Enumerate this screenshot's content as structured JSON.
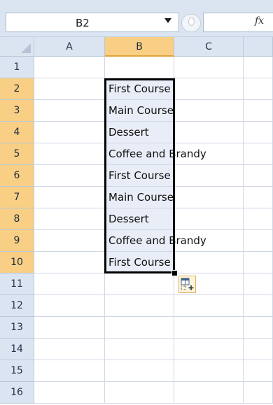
{
  "formula_bar": {
    "name_box": "B2",
    "function_label": "fx"
  },
  "columns": [
    {
      "label": "A",
      "selected": false
    },
    {
      "label": "B",
      "selected": true
    },
    {
      "label": "C",
      "selected": false
    }
  ],
  "rows": [
    {
      "label": "1",
      "selected": false,
      "b": ""
    },
    {
      "label": "2",
      "selected": true,
      "b": "First Course"
    },
    {
      "label": "3",
      "selected": true,
      "b": "Main Course"
    },
    {
      "label": "4",
      "selected": true,
      "b": "Dessert"
    },
    {
      "label": "5",
      "selected": true,
      "b": "Coffee and Brandy"
    },
    {
      "label": "6",
      "selected": true,
      "b": "First Course"
    },
    {
      "label": "7",
      "selected": true,
      "b": "Main Course"
    },
    {
      "label": "8",
      "selected": true,
      "b": "Dessert"
    },
    {
      "label": "9",
      "selected": true,
      "b": "Coffee and Brandy"
    },
    {
      "label": "10",
      "selected": true,
      "b": "First Course"
    },
    {
      "label": "11",
      "selected": false,
      "b": ""
    },
    {
      "label": "12",
      "selected": false,
      "b": ""
    },
    {
      "label": "13",
      "selected": false,
      "b": ""
    },
    {
      "label": "14",
      "selected": false,
      "b": ""
    },
    {
      "label": "15",
      "selected": false,
      "b": ""
    },
    {
      "label": "16",
      "selected": false,
      "b": ""
    }
  ],
  "selection": {
    "start": "B2",
    "end": "B10"
  },
  "colors": {
    "header_bg": "#dbe5f1",
    "header_selected_bg": "#f8cf84",
    "selection_bg": "#e9edf7",
    "gridline": "#d0d7e5",
    "selection_border": "#000000"
  },
  "icons": {
    "name_box_dropdown": "chevron-down-icon",
    "formula_bar_expander": "oval-icon",
    "auto_fill_options": "auto-fill-options-icon"
  }
}
